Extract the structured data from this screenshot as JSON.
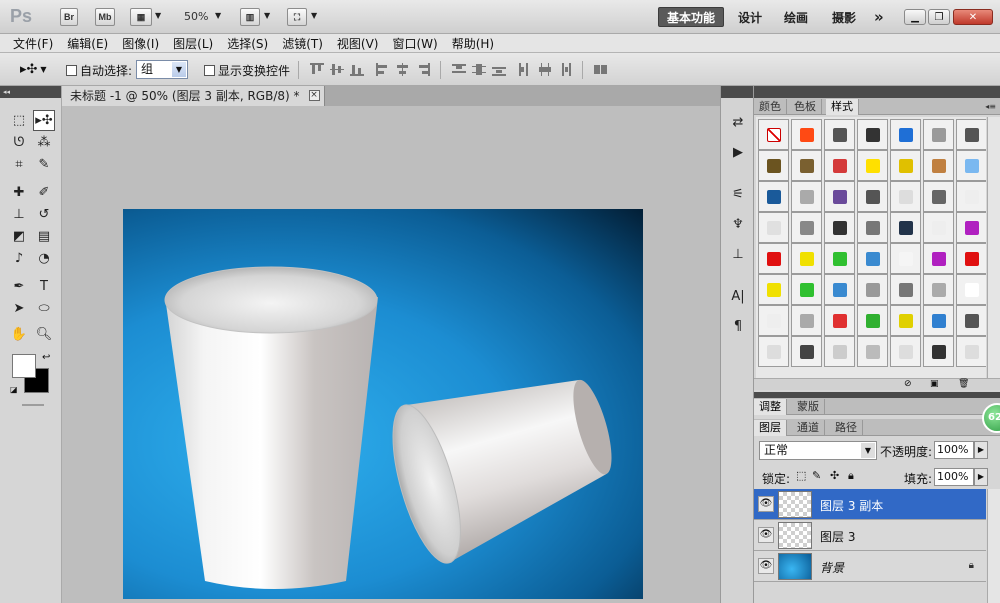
{
  "app": {
    "logo": "Ps",
    "bridge_label": "Br",
    "minibridge_label": "Mb",
    "zoom": "50%",
    "workspaces": [
      "基本功能",
      "设计",
      "绘画",
      "摄影"
    ],
    "more_label": "»"
  },
  "menu": [
    "文件(F)",
    "编辑(E)",
    "图像(I)",
    "图层(L)",
    "选择(S)",
    "滤镜(T)",
    "视图(V)",
    "窗口(W)",
    "帮助(H)"
  ],
  "options": {
    "auto_select_label": "自动选择:",
    "auto_select_value": "组",
    "show_transform_label": "显示变换控件"
  },
  "document": {
    "tab_title": "未标题 -1 @ 50% (图层 3 副本, RGB/8) *",
    "close_glyph": "×",
    "background_colors": [
      "#2fb0ee",
      "#1c8dd2",
      "#0b5d95",
      "#021e35"
    ]
  },
  "panels": {
    "styles_tabs": [
      "颜色",
      "色板",
      "样式"
    ],
    "adjust_tabs": [
      "调整",
      "蒙版"
    ],
    "layers_tabs": [
      "图层",
      "通道",
      "路径"
    ],
    "blend_mode": "正常",
    "opacity_label": "不透明度:",
    "opacity_value": "100%",
    "lock_label": "锁定:",
    "fill_label": "填充:",
    "fill_value": "100%",
    "layers": [
      {
        "name": "图层 3 副本",
        "selected": true
      },
      {
        "name": "图层 3",
        "selected": false
      },
      {
        "name": "背景",
        "selected": false
      }
    ],
    "badge": "62"
  },
  "colors": {
    "foreground": "#ffffff",
    "background": "#000000",
    "selection": "#3169c6"
  },
  "style_swatches": [
    "#ffffff",
    "#ff4a14",
    "#555555",
    "#333333",
    "#1f6fd6",
    "#9a9a9a",
    "#555555",
    "#6b5420",
    "#7a6030",
    "#d43a3a",
    "#ffe000",
    "#e0c000",
    "#c08040",
    "#7ab8f0",
    "#1a5a9a",
    "#aaaaaa",
    "#6a4a9a",
    "#555555",
    "#dddddd",
    "#666666",
    "#eeeeee",
    "#e0e0e0",
    "#888888",
    "#333333",
    "#777777",
    "#22334a",
    "#eeeeee",
    "#b020c0",
    "#e01010",
    "#f0e000",
    "#30c030",
    "#3a8ad0",
    "#f5f5f5",
    "#b020c0",
    "#e01010",
    "#f0e000",
    "#30c030",
    "#3a8ad0",
    "#999999",
    "#777777",
    "#aaaaaa",
    "#ffffff",
    "#eeeeee",
    "#aaaaaa",
    "#e03030",
    "#30b030",
    "#e0d000",
    "#3080d0",
    "#555555",
    "#dddddd",
    "#444444",
    "#cccccc",
    "#bbbbbb",
    "#dddddd",
    "#333333",
    "#dddddd"
  ]
}
